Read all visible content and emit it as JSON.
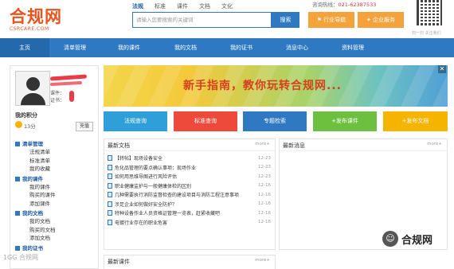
{
  "logo": {
    "name": "合规网",
    "domain": "CSRCARE.COM"
  },
  "search": {
    "tabs": [
      "法规",
      "标准",
      "课件",
      "文档",
      "文化"
    ],
    "placeholder": "请输入您要搜索的关键词",
    "button": "搜索"
  },
  "hotline": {
    "label": "咨询热线：",
    "number": "021-62387533"
  },
  "header_buttons": {
    "industry": "行业导航",
    "enterprise": "企业服务"
  },
  "qr_caption": "扫一扫 关注我们",
  "nav": [
    "主页",
    "清单管理",
    "我的课件",
    "我的文档",
    "我的证书",
    "消息中心",
    "资料管理"
  ],
  "user": {
    "course_label": "课件：",
    "cert_label": "证书：",
    "points_label": "我的积分",
    "points_value": "13分",
    "recharge": "充值"
  },
  "menu": [
    {
      "title": "清单管理",
      "items": [
        "法规清单",
        "标准清单",
        "我的收藏"
      ]
    },
    {
      "title": "我的课件",
      "items": [
        "我的课件",
        "购买的课件",
        "添加课件"
      ]
    },
    {
      "title": "我的文档",
      "items": [
        "我的文档",
        "购买的文档",
        "添加文档"
      ]
    },
    {
      "title": "我的证书",
      "items": []
    }
  ],
  "banner": {
    "text": "新手指南，教你玩转合规网...",
    "close": "✕"
  },
  "quick_buttons": [
    "法规查询",
    "标准查询",
    "专题检索",
    "+发布课件",
    "+发布文档"
  ],
  "latest_docs": {
    "title": "最新文档",
    "more": "more+",
    "items": [
      {
        "title": "【转帖】现场设备安全",
        "date": "12-23"
      },
      {
        "title": "危化品管理的要点确认事项：现场作业",
        "date": "12-23"
      },
      {
        "title": "如何用思维导图进行风险评估",
        "date": "12-23"
      },
      {
        "title": "职业健康监护与一般健康体检的区别",
        "date": "12-16"
      },
      {
        "title": "几种需要执行消防监督检查的建设项目与消防工程注意事项",
        "date": "12-16"
      },
      {
        "title": "涉足企业如何做好安全防护？",
        "date": "12-16"
      },
      {
        "title": "特种设备作业人员资格证管理一览表，赶紧收藏吧",
        "date": "12-16"
      },
      {
        "title": "电镀行业存在的职业危害",
        "date": "12-16"
      }
    ]
  },
  "latest_msgs": {
    "title": "最新消息",
    "more": "more+"
  },
  "new_courses": {
    "title": "最新课件",
    "more": "more+"
  },
  "watermark": {
    "text": "合规网",
    "left": "1GG 合规网"
  },
  "colors": {
    "primary": "#2e79c2",
    "accent": "#e8541d",
    "orange": "#f6a23a",
    "red": "#ee4a3b",
    "green": "#6cbf3f",
    "yellow": "#f5b400"
  }
}
